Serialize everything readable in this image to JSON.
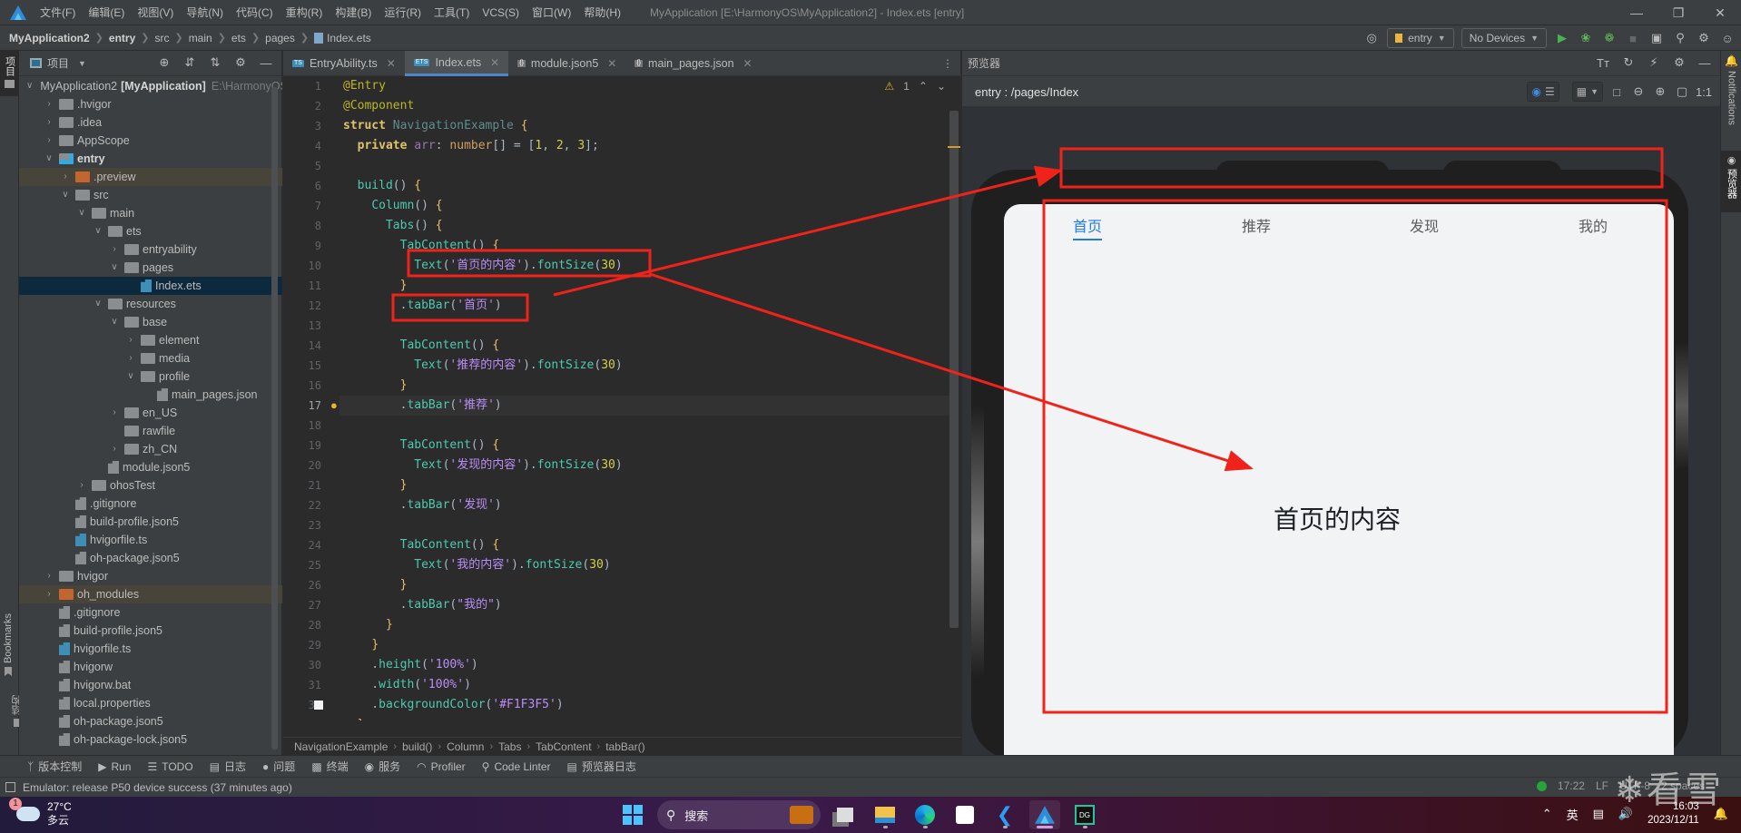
{
  "app": {
    "menu": [
      "文件(F)",
      "编辑(E)",
      "视图(V)",
      "导航(N)",
      "代码(C)",
      "重构(R)",
      "构建(B)",
      "运行(R)",
      "工具(T)",
      "VCS(S)",
      "窗口(W)",
      "帮助(H)"
    ],
    "window_title": "MyApplication [E:\\HarmonyOS\\MyApplication2] - Index.ets [entry]",
    "accent_color": "#4a88c7"
  },
  "navbar": {
    "breadcrumb": [
      "MyApplication2",
      "entry",
      "src",
      "main",
      "ets",
      "pages",
      "Index.ets"
    ],
    "module_combo": "entry",
    "device_combo": "No Devices"
  },
  "left_stripe": {
    "project_label": "项目",
    "bookmarks_label": "Bookmarks",
    "structure_label": "结构"
  },
  "project": {
    "title": "项目",
    "tree": [
      {
        "name": "MyApplication2",
        "suffix": "[MyApplication]",
        "hint": "E:\\HarmonyOS",
        "depth": 0,
        "expanded": true,
        "type": "module"
      },
      {
        "name": ".hvigor",
        "depth": 1,
        "expanded": false,
        "type": "folder"
      },
      {
        "name": ".idea",
        "depth": 1,
        "expanded": false,
        "type": "folder"
      },
      {
        "name": "AppScope",
        "depth": 1,
        "expanded": false,
        "type": "folder"
      },
      {
        "name": "entry",
        "depth": 1,
        "expanded": true,
        "type": "module",
        "bold": true
      },
      {
        "name": ".preview",
        "depth": 2,
        "expanded": false,
        "type": "folder-excluded"
      },
      {
        "name": "src",
        "depth": 2,
        "expanded": true,
        "type": "folder"
      },
      {
        "name": "main",
        "depth": 3,
        "expanded": true,
        "type": "folder"
      },
      {
        "name": "ets",
        "depth": 4,
        "expanded": true,
        "type": "folder"
      },
      {
        "name": "entryability",
        "depth": 5,
        "expanded": false,
        "type": "folder"
      },
      {
        "name": "pages",
        "depth": 5,
        "expanded": true,
        "type": "folder"
      },
      {
        "name": "Index.ets",
        "depth": 6,
        "type": "file-ets",
        "selected": true
      },
      {
        "name": "resources",
        "depth": 4,
        "expanded": true,
        "type": "folder"
      },
      {
        "name": "base",
        "depth": 5,
        "expanded": true,
        "type": "folder"
      },
      {
        "name": "element",
        "depth": 6,
        "expanded": false,
        "type": "folder"
      },
      {
        "name": "media",
        "depth": 6,
        "expanded": false,
        "type": "folder"
      },
      {
        "name": "profile",
        "depth": 6,
        "expanded": true,
        "type": "folder"
      },
      {
        "name": "main_pages.json",
        "depth": 7,
        "type": "file-json"
      },
      {
        "name": "en_US",
        "depth": 5,
        "expanded": false,
        "type": "folder"
      },
      {
        "name": "rawfile",
        "depth": 5,
        "type": "folder"
      },
      {
        "name": "zh_CN",
        "depth": 5,
        "expanded": false,
        "type": "folder"
      },
      {
        "name": "module.json5",
        "depth": 4,
        "type": "file-json"
      },
      {
        "name": "ohosTest",
        "depth": 3,
        "expanded": false,
        "type": "folder"
      },
      {
        "name": ".gitignore",
        "depth": 2,
        "type": "file"
      },
      {
        "name": "build-profile.json5",
        "depth": 2,
        "type": "file-json"
      },
      {
        "name": "hvigorfile.ts",
        "depth": 2,
        "type": "file-ts"
      },
      {
        "name": "oh-package.json5",
        "depth": 2,
        "type": "file-json"
      },
      {
        "name": "hvigor",
        "depth": 1,
        "expanded": false,
        "type": "folder"
      },
      {
        "name": "oh_modules",
        "depth": 1,
        "expanded": false,
        "type": "folder-excluded"
      },
      {
        "name": ".gitignore",
        "depth": 1,
        "type": "file"
      },
      {
        "name": "build-profile.json5",
        "depth": 1,
        "type": "file-json"
      },
      {
        "name": "hvigorfile.ts",
        "depth": 1,
        "type": "file-ts"
      },
      {
        "name": "hvigorw",
        "depth": 1,
        "type": "file"
      },
      {
        "name": "hvigorw.bat",
        "depth": 1,
        "type": "file"
      },
      {
        "name": "local.properties",
        "depth": 1,
        "type": "file"
      },
      {
        "name": "oh-package.json5",
        "depth": 1,
        "type": "file-json"
      },
      {
        "name": "oh-package-lock.json5",
        "depth": 1,
        "type": "file-json"
      }
    ]
  },
  "editor": {
    "tabs": [
      {
        "label": "EntryAbility.ts",
        "badge": "TS",
        "active": false
      },
      {
        "label": "Index.ets",
        "badge": "ETS",
        "active": true
      },
      {
        "label": "module.json5",
        "badge": "{}",
        "active": false
      },
      {
        "label": "main_pages.json",
        "badge": "{}",
        "active": false
      }
    ],
    "warnings_count": "1",
    "current_line": 17,
    "lines": [
      "@Entry",
      "@Component",
      "struct NavigationExample {",
      "  private arr: number[] = [1, 2, 3];",
      "",
      "  build() {",
      "    Column() {",
      "      Tabs() {",
      "        TabContent() {",
      "          Text('首页的内容').fontSize(30)",
      "        }",
      "        .tabBar('首页')",
      "",
      "        TabContent() {",
      "          Text('推荐的内容').fontSize(30)",
      "        }",
      "        .tabBar('推荐')",
      "",
      "        TabContent() {",
      "          Text('发现的内容').fontSize(30)",
      "        }",
      "        .tabBar('发现')",
      "",
      "        TabContent() {",
      "          Text('我的内容').fontSize(30)",
      "        }",
      "        .tabBar(\"我的\")",
      "      }",
      "    }",
      "    .height('100%')",
      "    .width('100%')",
      "    .backgroundColor('#F1F3F5')",
      "  }"
    ],
    "breadcrumbs": [
      "NavigationExample",
      "build()",
      "Column",
      "Tabs",
      "TabContent",
      "tabBar()"
    ]
  },
  "preview": {
    "panel_title": "预览器",
    "route": "entry : /pages/Index",
    "zoom_label": "1:1",
    "app_tabs": [
      "首页",
      "推荐",
      "发现",
      "我的"
    ],
    "active_tab": 0,
    "content_text": "首页的内容",
    "page_background": "#F1F3F5",
    "active_tab_color": "#1f7ce5"
  },
  "right_stripe": {
    "notifications_label": "Notifications",
    "previewer_label": "预览器"
  },
  "bottom_tools": [
    "版本控制",
    "Run",
    "TODO",
    "日志",
    "问题",
    "终端",
    "服务",
    "Profiler",
    "Code Linter",
    "预览器日志"
  ],
  "status": {
    "message": "Emulator: release P50 device success (37 minutes ago)",
    "position": "17:22",
    "line_sep": "LF",
    "encoding": "UTF-8",
    "indent": "2 spaces"
  },
  "taskbar": {
    "weather_temp": "27°C",
    "weather_desc": "多云",
    "weather_badge": "1",
    "search_placeholder": "搜索",
    "ime": "英",
    "time": "16:03",
    "date": "2023/12/11"
  },
  "watermark": "看雪",
  "annotation_color": "#f0231b"
}
